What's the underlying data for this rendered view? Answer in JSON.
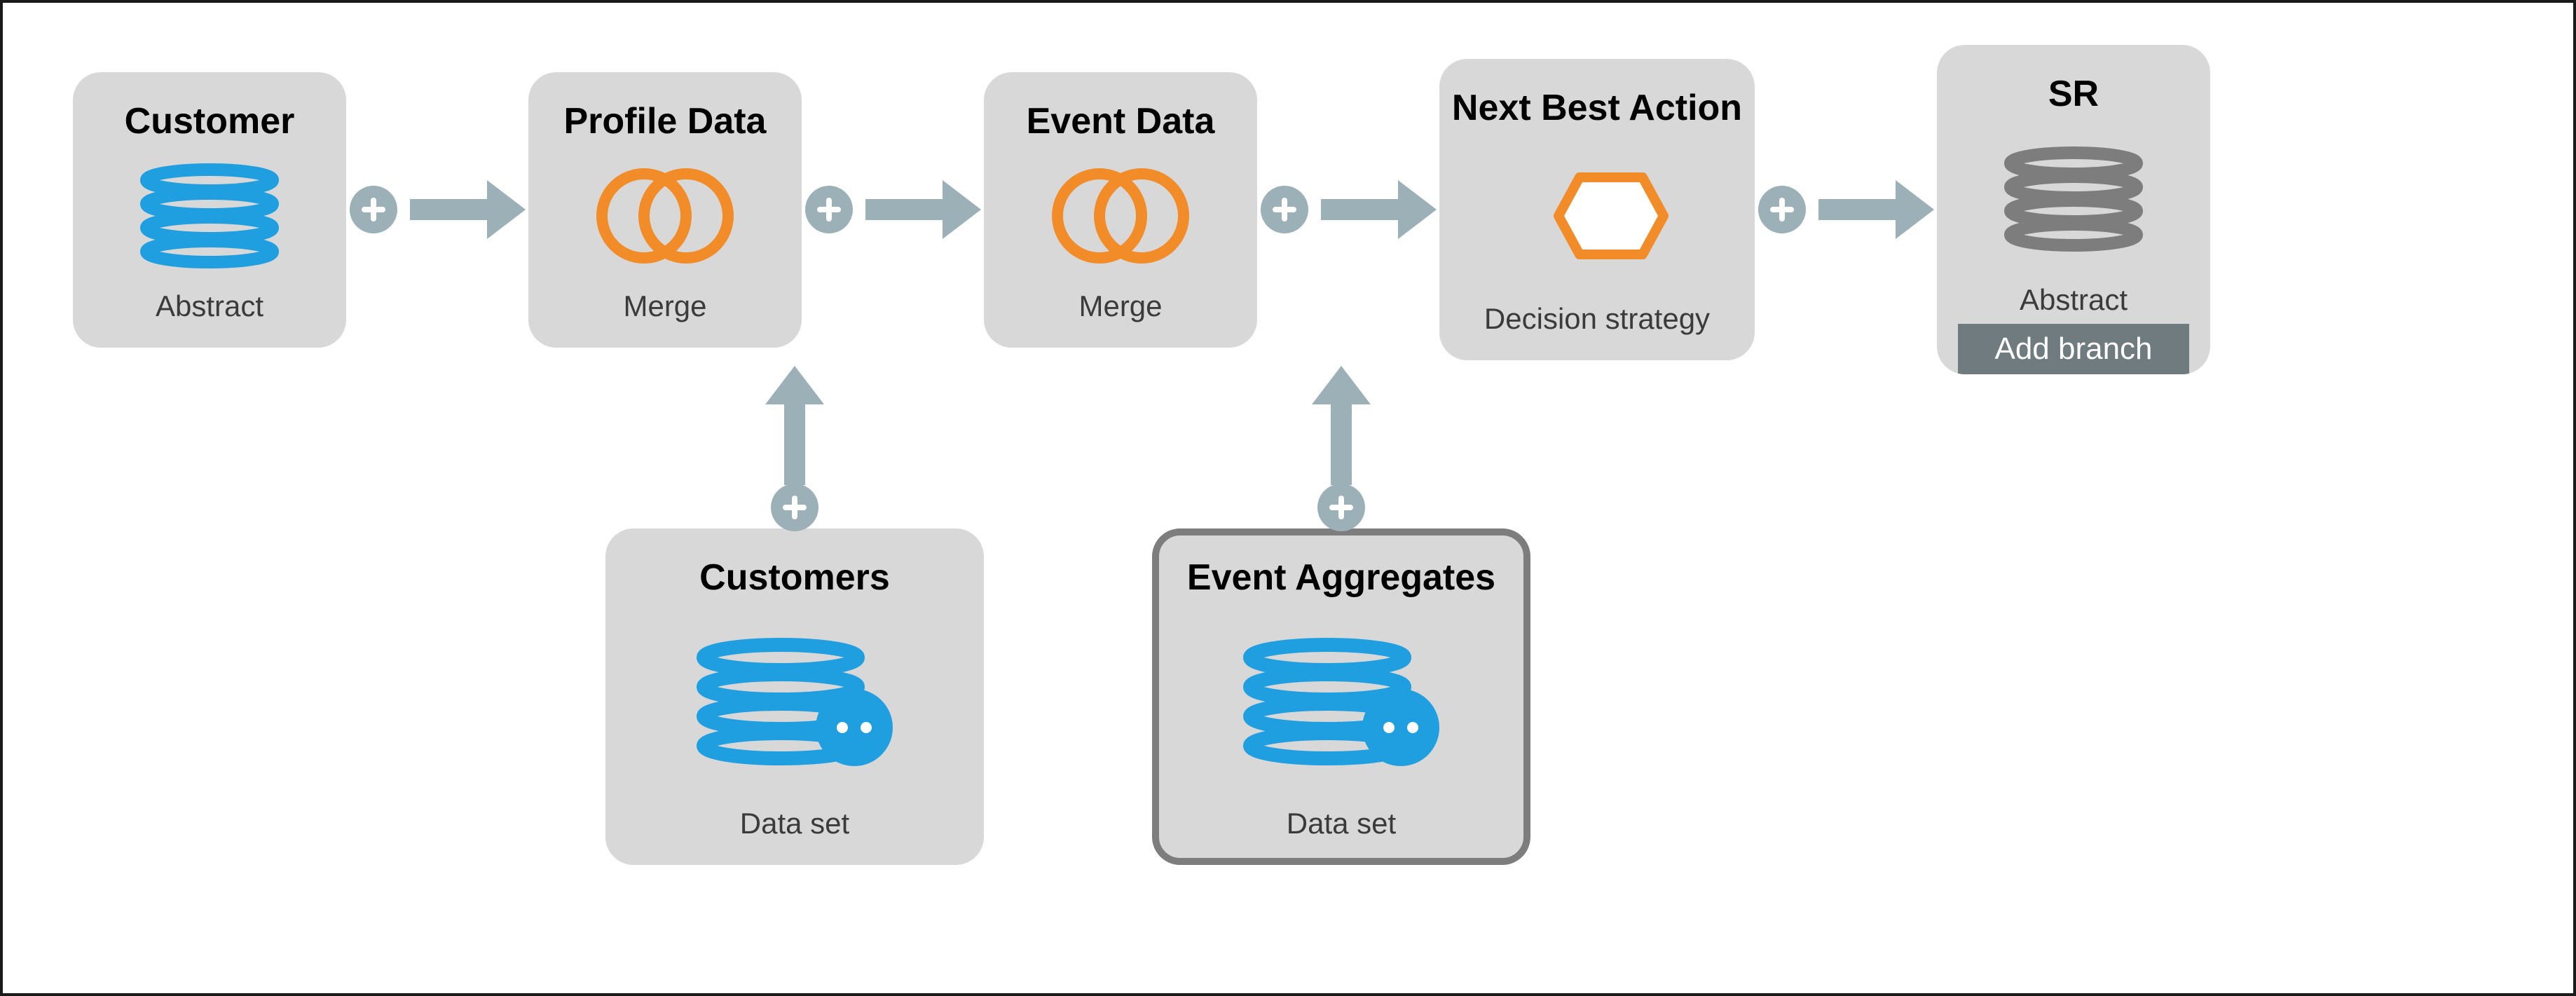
{
  "nodes": {
    "customer": {
      "title": "Customer",
      "sub": "Abstract",
      "icon": "stack-blue"
    },
    "profile": {
      "title": "Profile Data",
      "sub": "Merge",
      "icon": "venn-orange"
    },
    "event": {
      "title": "Event Data",
      "sub": "Merge",
      "icon": "venn-orange"
    },
    "nba": {
      "title": "Next Best Action",
      "sub": "Decision strategy",
      "icon": "hex-orange"
    },
    "sr": {
      "title": "SR",
      "sub": "Abstract",
      "icon": "stack-grey",
      "button": "Add branch"
    },
    "customers": {
      "title": "Customers",
      "sub": "Data set",
      "icon": "dataset-blue"
    },
    "eventagg": {
      "title": "Event Aggregates",
      "sub": "Data set",
      "icon": "dataset-blue"
    }
  },
  "flow_top": [
    "customer",
    "profile",
    "event",
    "nba",
    "sr"
  ],
  "feeds": {
    "customers": "profile",
    "eventagg": "event"
  },
  "selected": "eventagg",
  "colors": {
    "box": "#d8d8d8",
    "arrow": "#9cb0b7",
    "blue": "#1f9fe0",
    "orange": "#f28c28",
    "btn": "#6f7b7f"
  }
}
